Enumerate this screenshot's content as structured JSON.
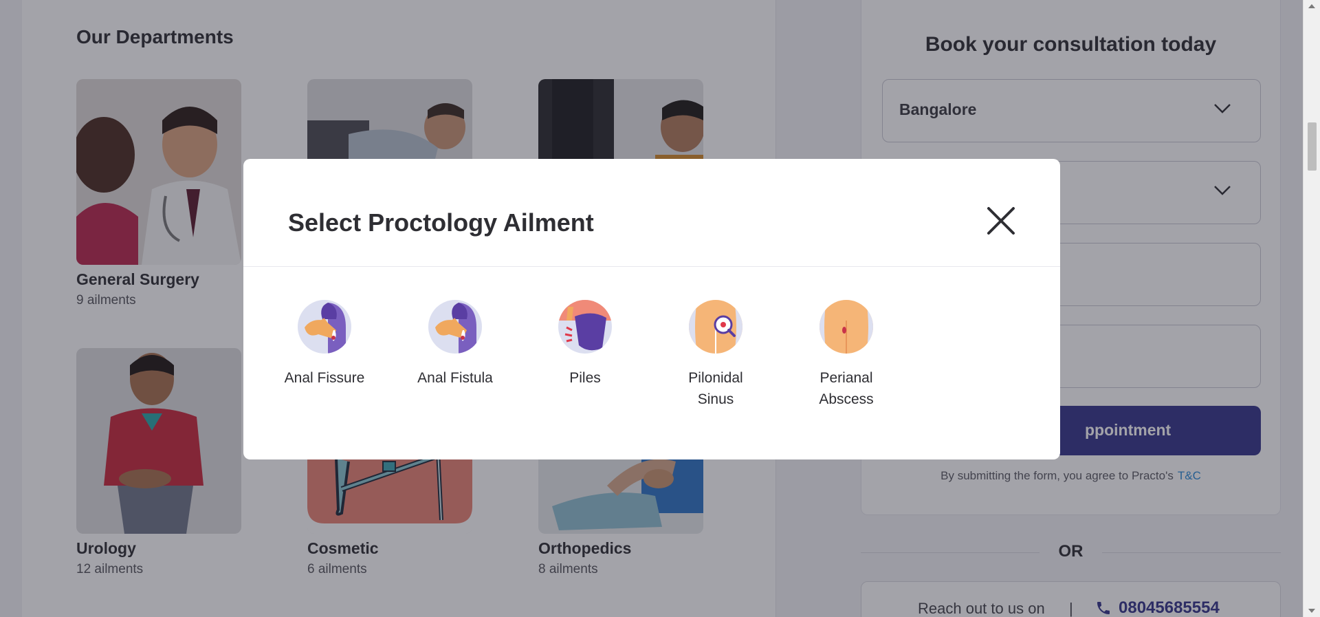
{
  "departments": {
    "heading": "Our Departments",
    "items": [
      {
        "name": "General Surgery",
        "count": "9 ailments"
      },
      {
        "name": "",
        "count": ""
      },
      {
        "name": "",
        "count": ""
      },
      {
        "name": "Urology",
        "count": "12 ailments"
      },
      {
        "name": "Cosmetic",
        "count": "6 ailments"
      },
      {
        "name": "Orthopedics",
        "count": "8 ailments"
      }
    ]
  },
  "booking": {
    "title": "Book your consultation today",
    "city_value": "Bangalore",
    "button_label": "ppointment",
    "terms_text": "By submitting the form, you agree to Practo's",
    "terms_link": "T&C"
  },
  "contact": {
    "or_text": "OR",
    "reach_text": "Reach out to us on",
    "separator": "|",
    "phone": "08045685554"
  },
  "modal": {
    "title": "Select Proctology Ailment",
    "ailments": [
      {
        "label": "Anal Fissure",
        "icon": "anal-fissure-icon"
      },
      {
        "label": "Anal Fistula",
        "icon": "anal-fistula-icon"
      },
      {
        "label": "Piles",
        "icon": "piles-icon"
      },
      {
        "label": "Pilonidal Sinus",
        "icon": "pilonidal-sinus-icon"
      },
      {
        "label": "Perianal Abscess",
        "icon": "perianal-abscess-icon"
      }
    ]
  },
  "colors": {
    "primary": "#35358a",
    "link": "#2a8ad6",
    "overlay": "rgba(35,35,50,0.42)"
  }
}
